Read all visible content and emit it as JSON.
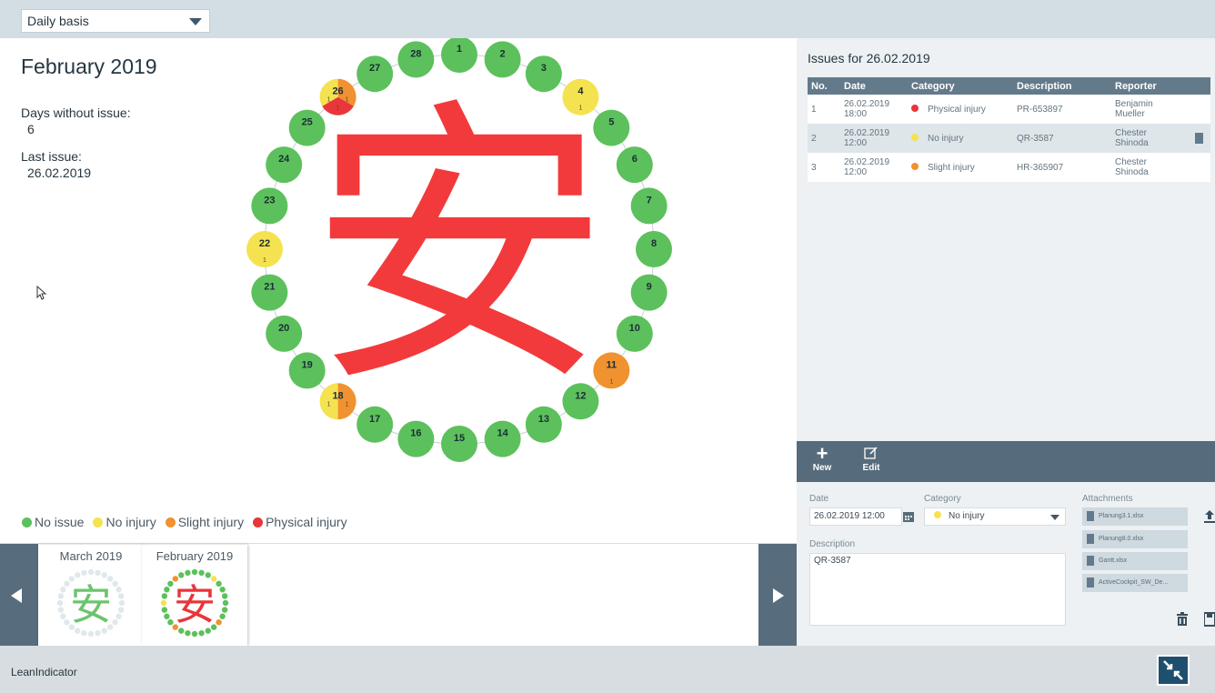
{
  "top": {
    "period_select": "Daily basis"
  },
  "summary": {
    "month_title": "February 2019",
    "days_without_issue_label": "Days without issue:",
    "days_without_issue_value": "6",
    "last_issue_label": "Last issue:",
    "last_issue_value": "26.02.2019"
  },
  "calendar": {
    "symbol": "安",
    "days": [
      {
        "day": "1",
        "status": "no-issue"
      },
      {
        "day": "2",
        "status": "no-issue"
      },
      {
        "day": "3",
        "status": "no-issue"
      },
      {
        "day": "4",
        "status": "no-injury",
        "count": "1"
      },
      {
        "day": "5",
        "status": "no-issue"
      },
      {
        "day": "6",
        "status": "no-issue"
      },
      {
        "day": "7",
        "status": "no-issue"
      },
      {
        "day": "8",
        "status": "no-issue"
      },
      {
        "day": "9",
        "status": "no-issue"
      },
      {
        "day": "10",
        "status": "no-issue"
      },
      {
        "day": "11",
        "status": "slight-injury",
        "count": "1"
      },
      {
        "day": "12",
        "status": "no-issue"
      },
      {
        "day": "13",
        "status": "no-issue"
      },
      {
        "day": "14",
        "status": "no-issue"
      },
      {
        "day": "15",
        "status": "no-issue"
      },
      {
        "day": "16",
        "status": "no-issue"
      },
      {
        "day": "17",
        "status": "no-issue"
      },
      {
        "day": "18",
        "status": "mixed",
        "counts": [
          "1",
          "1"
        ]
      },
      {
        "day": "19",
        "status": "no-issue"
      },
      {
        "day": "20",
        "status": "no-issue"
      },
      {
        "day": "21",
        "status": "no-issue"
      },
      {
        "day": "22",
        "status": "no-injury",
        "count": "1"
      },
      {
        "day": "23",
        "status": "no-issue"
      },
      {
        "day": "24",
        "status": "no-issue"
      },
      {
        "day": "25",
        "status": "no-issue"
      },
      {
        "day": "26",
        "status": "mixed3",
        "counts": [
          "1",
          "1",
          "1"
        ]
      },
      {
        "day": "27",
        "status": "no-issue"
      },
      {
        "day": "28",
        "status": "no-issue"
      }
    ],
    "colors": {
      "no-issue": "#5cc15c",
      "no-injury": "#f5e250",
      "slight-injury": "#f0922f",
      "physical-injury": "#e8363a",
      "symbol": "#f23a3c"
    }
  },
  "legend": [
    {
      "label": "No issue",
      "color": "#5cc15c"
    },
    {
      "label": "No injury",
      "color": "#f5e250"
    },
    {
      "label": "Slight injury",
      "color": "#f0922f"
    },
    {
      "label": "Physical injury",
      "color": "#e8363a"
    }
  ],
  "thumbnails": [
    {
      "label": "March 2019",
      "symbol": "安",
      "symbol_color": "#6cc46c"
    },
    {
      "label": "February 2019",
      "symbol": "安",
      "symbol_color": "#e8363a"
    }
  ],
  "issues": {
    "title": "Issues for 26.02.2019",
    "columns": [
      "No.",
      "Date",
      "Category",
      "Description",
      "Reporter"
    ],
    "rows": [
      {
        "no": "1",
        "date": "26.02.2019",
        "time": "18:00",
        "category": "Physical injury",
        "cat_color": "#e8363a",
        "description": "PR-653897",
        "reporter_first": "Benjamin",
        "reporter_last": "Mueller"
      },
      {
        "no": "2",
        "date": "26.02.2019",
        "time": "12:00",
        "category": "No injury",
        "cat_color": "#f5e250",
        "description": "QR-3587",
        "reporter_first": "Chester",
        "reporter_last": "Shinoda"
      },
      {
        "no": "3",
        "date": "26.02.2019",
        "time": "12:00",
        "category": "Slight injury",
        "cat_color": "#f0922f",
        "description": "HR-365907",
        "reporter_first": "Chester",
        "reporter_last": "Shinoda"
      }
    ]
  },
  "edit_toolbar": {
    "new_label": "New",
    "edit_label": "Edit"
  },
  "form": {
    "date_label": "Date",
    "date_value": "26.02.2019 12:00",
    "category_label": "Category",
    "category_value": "No injury",
    "category_color": "#f5e250",
    "attachments_label": "Attachments",
    "attachments": [
      "Planung3.1.xlsx",
      "Planung8.0.xlsx",
      "Gantt.xlsx",
      "ActiveCockpit_SW_De..."
    ],
    "description_label": "Description",
    "description_value": "QR-3587"
  },
  "footer": {
    "app_name": "LeanIndicator"
  }
}
